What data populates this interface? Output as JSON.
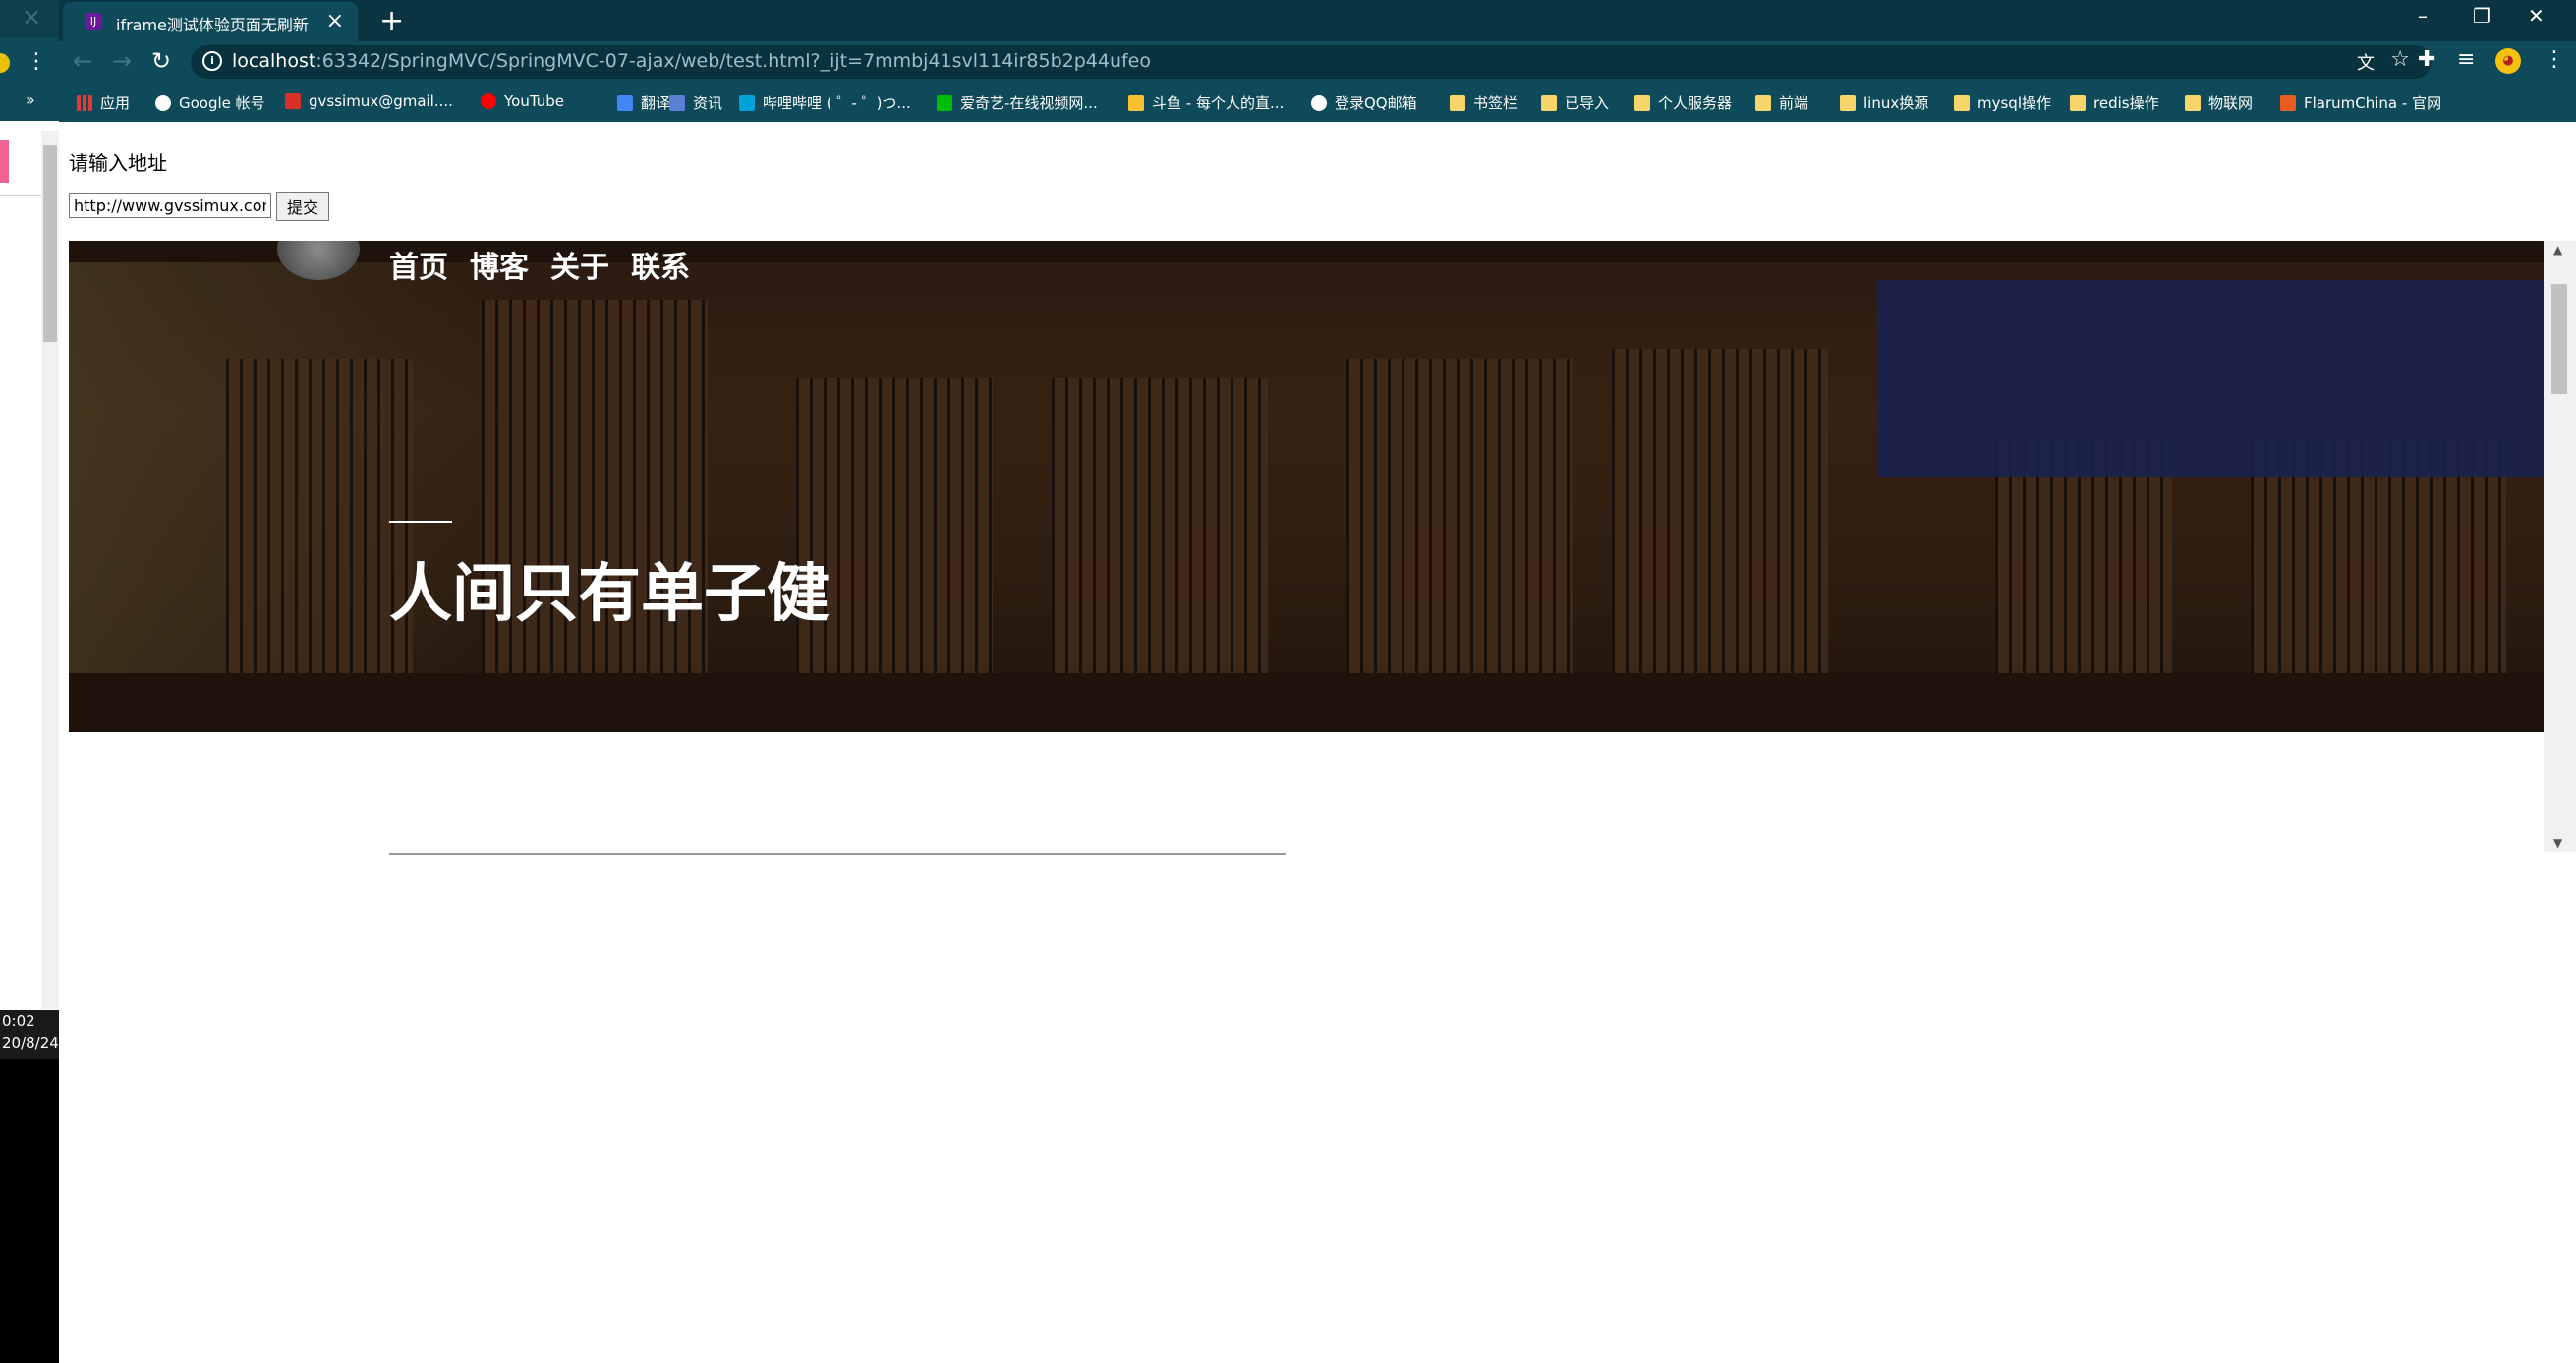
{
  "left_strip": {
    "time": "0:02",
    "date": "20/8/24"
  },
  "tab": {
    "title": "iframe测试体验页面无刷新",
    "favicon_text": "IJ"
  },
  "toolbar": {
    "url_host": "localhost",
    "url_rest": ":63342/SpringMVC/SpringMVC-07-ajax/web/test.html?_ijt=7mmbj41svl114ir85b2p44ufeo"
  },
  "bookmarks": [
    {
      "label": "应用",
      "icon": "apps"
    },
    {
      "label": "Google 帐号",
      "icon": "g"
    },
    {
      "label": "gvssimux@gmail....",
      "icon": "mail"
    },
    {
      "label": "YouTube",
      "icon": "yt"
    },
    {
      "label": "翻译",
      "icon": "tr"
    },
    {
      "label": "资讯",
      "icon": "gb"
    },
    {
      "label": "哔哩哔哩 ( ゜- ゜)つ...",
      "icon": "bili"
    },
    {
      "label": "爱奇艺-在线视频网...",
      "icon": "iqy"
    },
    {
      "label": "斗鱼 - 每个人的直...",
      "icon": "dy"
    },
    {
      "label": "登录QQ邮箱",
      "icon": "qq"
    },
    {
      "label": "书签栏",
      "icon": "folder"
    },
    {
      "label": "已导入",
      "icon": "folder"
    },
    {
      "label": "个人服务器",
      "icon": "folder"
    },
    {
      "label": "前端",
      "icon": "folder"
    },
    {
      "label": "linux换源",
      "icon": "folder"
    },
    {
      "label": "mysql操作",
      "icon": "folder"
    },
    {
      "label": "redis操作",
      "icon": "folder"
    },
    {
      "label": "物联网",
      "icon": "folder"
    },
    {
      "label": "FlarumChina - 官网",
      "icon": "fl"
    }
  ],
  "page": {
    "prompt": "请输入地址",
    "address_value": "http://www.gvssimux.com",
    "submit_label": "提交"
  },
  "iframe": {
    "nav": [
      "首页",
      "博客",
      "关于",
      "联系"
    ],
    "headline": "人间只有单子健"
  }
}
